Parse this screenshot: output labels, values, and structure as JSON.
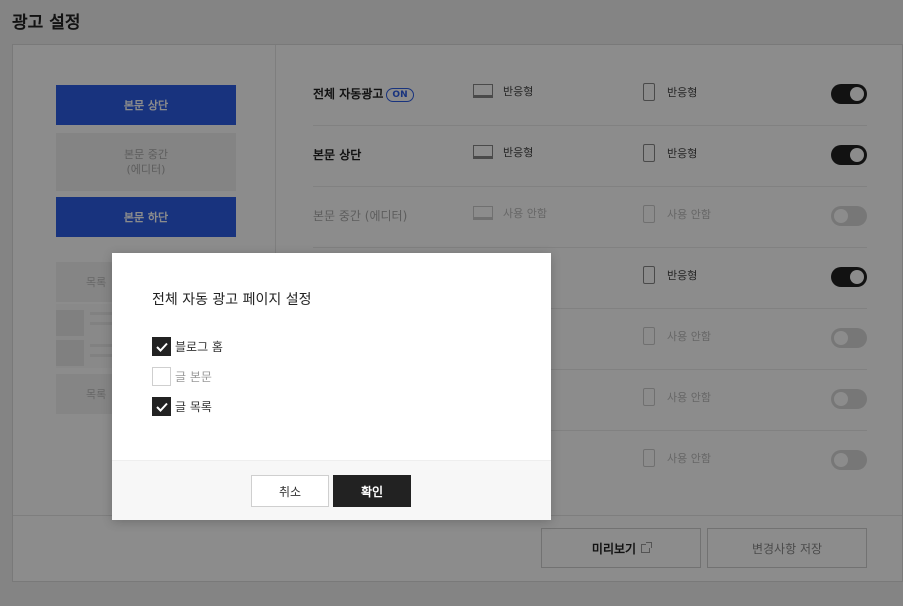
{
  "page": {
    "title": "광고 설정"
  },
  "preview": {
    "top_label": "본문 상단",
    "middle_label_line1": "본문 중간",
    "middle_label_line2": "(에디터)",
    "bottom_label": "본문 하단",
    "list_label_1": "목록",
    "list_label_2": "목록"
  },
  "rows": [
    {
      "name": "전체 자동광고",
      "badge": "ON",
      "pc": "반응형",
      "mobile": "반응형",
      "enabled": true
    },
    {
      "name": "본문 상단",
      "pc": "반응형",
      "mobile": "반응형",
      "enabled": true
    },
    {
      "name": "본문 중간 (에디터)",
      "pc": "사용 안함",
      "mobile": "사용 안함",
      "enabled": false
    },
    {
      "name": "",
      "pc": "",
      "mobile": "반응형",
      "enabled": true
    },
    {
      "name": "",
      "pc": "",
      "mobile": "사용 안함",
      "enabled": false
    },
    {
      "name": "",
      "pc": "",
      "mobile": "사용 안함",
      "enabled": false
    },
    {
      "name": "",
      "pc": "",
      "mobile": "사용 안함",
      "enabled": false
    }
  ],
  "footer": {
    "preview_label": "미리보기",
    "save_label": "변경사항 저장"
  },
  "modal": {
    "title": "전체 자동 광고 페이지 설정",
    "options": [
      {
        "label": "블로그 홈",
        "checked": true
      },
      {
        "label": "글 본문",
        "checked": false
      },
      {
        "label": "글 목록",
        "checked": true
      }
    ],
    "cancel_label": "취소",
    "ok_label": "확인"
  },
  "colors": {
    "accent": "#2d5ee6",
    "dark": "#222222",
    "overlay": "rgba(0,0,0,0.45)"
  },
  "icons": [
    "desktop-icon",
    "mobile-icon",
    "external-link-icon",
    "check-icon"
  ]
}
